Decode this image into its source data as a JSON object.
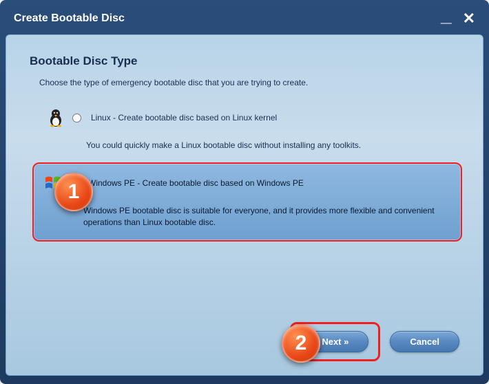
{
  "titlebar": {
    "title": "Create Bootable Disc"
  },
  "section": {
    "title": "Bootable Disc Type",
    "description": "Choose the type of emergency bootable disc that you are trying to create."
  },
  "options": {
    "linux": {
      "label": "Linux - Create bootable disc based on Linux kernel",
      "detail": "You could quickly make a Linux bootable disc without installing any toolkits.",
      "selected": false
    },
    "winpe": {
      "label": "Windows PE - Create bootable disc based on Windows PE",
      "detail": "Windows PE bootable disc is suitable for everyone, and it provides more flexible and convenient operations than Linux bootable disc.",
      "selected": true
    }
  },
  "buttons": {
    "next": "Next  »",
    "cancel": "Cancel"
  },
  "callouts": {
    "one": "1",
    "two": "2"
  }
}
